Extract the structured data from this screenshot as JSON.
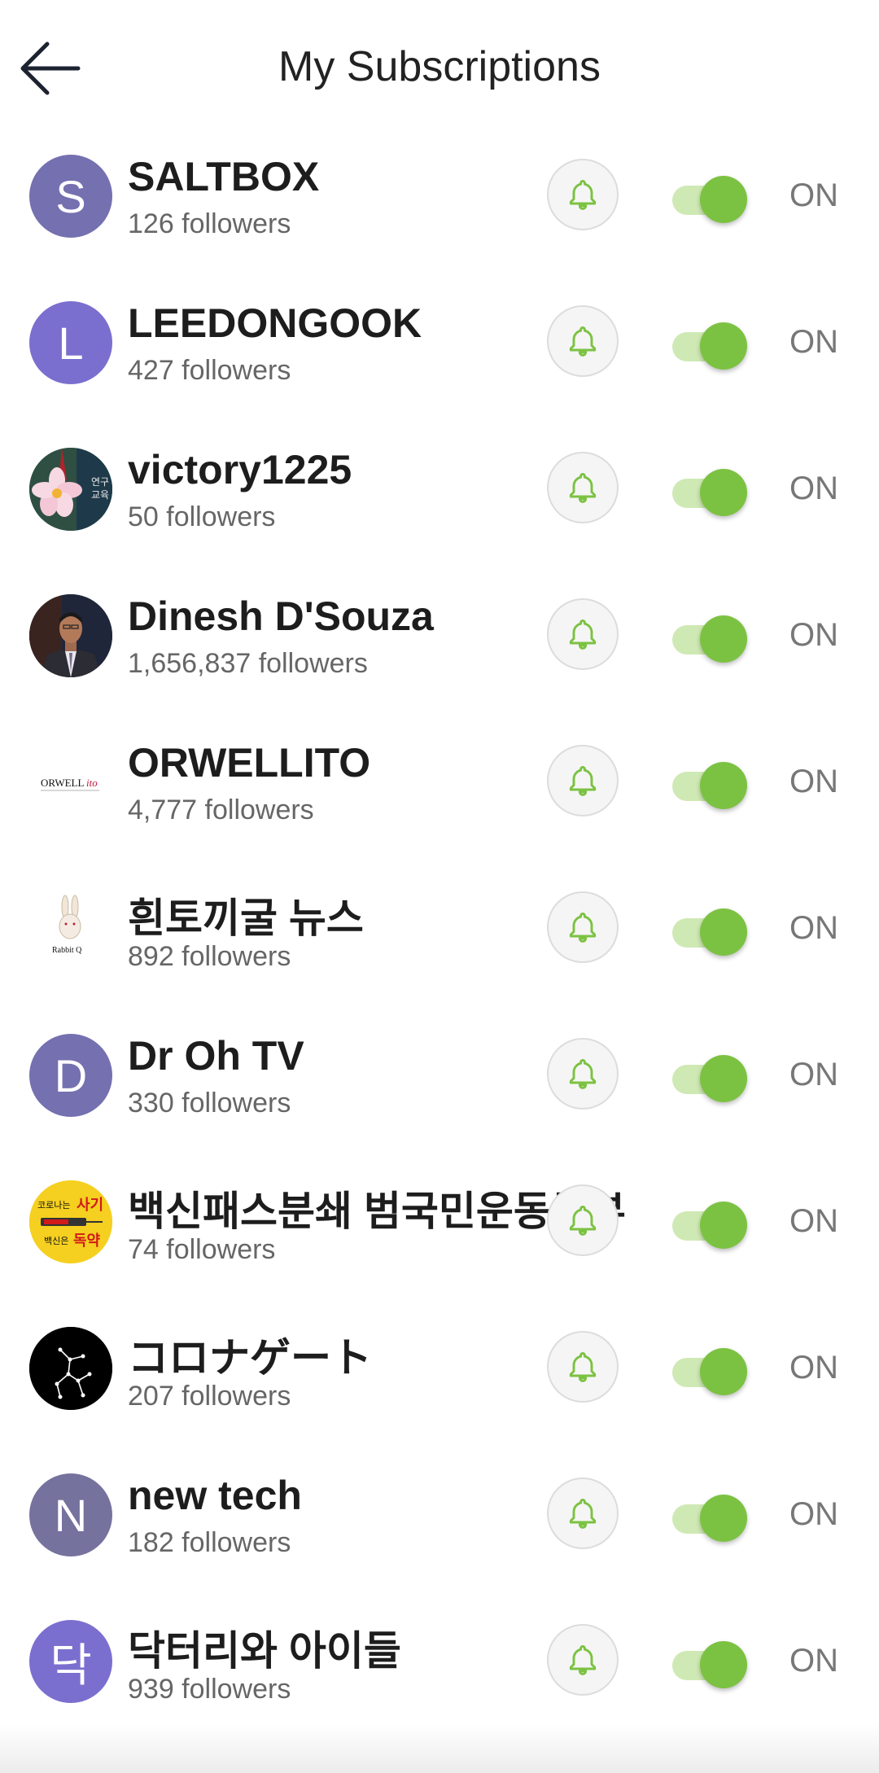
{
  "header": {
    "title": "My Subscriptions"
  },
  "accent_color": "#7cc242",
  "subscriptions": [
    {
      "name": "SALTBOX",
      "followers": "126 followers",
      "avatar_letter": "S",
      "avatar_color": "#7570b0",
      "status": "ON"
    },
    {
      "name": "LEEDONGOOK",
      "followers": "427 followers",
      "avatar_letter": "L",
      "avatar_color": "#7a6fcf",
      "status": "ON"
    },
    {
      "name": "victory1225",
      "followers": "50 followers",
      "avatar_letter": "",
      "avatar_color": "#2a4a3e",
      "avatar_text": "연구 교육",
      "status": "ON"
    },
    {
      "name": "Dinesh D'Souza",
      "followers": "1,656,837 followers",
      "avatar_letter": "",
      "avatar_color": "#1e2230",
      "status": "ON"
    },
    {
      "name": "ORWELLITO",
      "followers": "4,777 followers",
      "avatar_letter": "",
      "avatar_color": "#ffffff",
      "avatar_text": "ORWELLITO",
      "status": "ON"
    },
    {
      "name": "흰토끼굴 뉴스",
      "followers": "892 followers",
      "avatar_letter": "",
      "avatar_color": "#ffffff",
      "avatar_text": "Rabbit Q",
      "status": "ON"
    },
    {
      "name": "Dr Oh TV",
      "followers": "330 followers",
      "avatar_letter": "D",
      "avatar_color": "#7570b0",
      "status": "ON"
    },
    {
      "name": "백신패스분쇄 범국민운동본부",
      "followers": "74 followers",
      "avatar_letter": "",
      "avatar_color": "#f5d020",
      "avatar_text_top": "코로나는 사기",
      "avatar_text_bottom": "백신은 독약",
      "status": "ON"
    },
    {
      "name": "コロナゲート",
      "followers": "207 followers",
      "avatar_letter": "",
      "avatar_color": "#000000",
      "status": "ON"
    },
    {
      "name": "new tech",
      "followers": "182 followers",
      "avatar_letter": "N",
      "avatar_color": "#76729e",
      "status": "ON"
    },
    {
      "name": "닥터리와 아이들",
      "followers": "939 followers",
      "avatar_letter": "닥",
      "avatar_color": "#7a6fcf",
      "status": "ON"
    }
  ]
}
